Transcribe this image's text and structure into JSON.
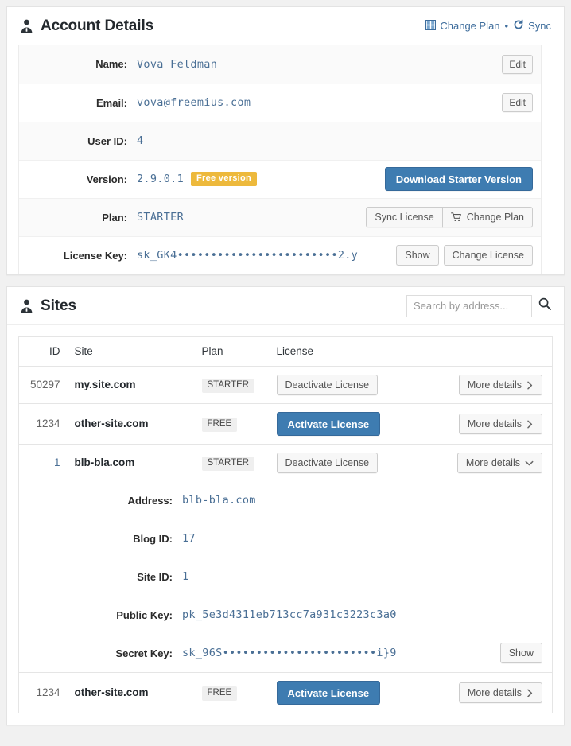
{
  "account": {
    "title": "Account Details",
    "header_links": {
      "change_plan": "Change Plan",
      "separator": "•",
      "sync": "Sync"
    },
    "rows": [
      {
        "label": "Name:",
        "value": "Vova Feldman",
        "action": "Edit"
      },
      {
        "label": "Email:",
        "value": "vova@freemius.com",
        "action": "Edit"
      },
      {
        "label": "User ID:",
        "value": "4",
        "action": ""
      },
      {
        "label": "Version:",
        "value": "2.9.0.1",
        "badge": "Free version",
        "action": "Download Starter Version"
      },
      {
        "label": "Plan:",
        "value": "STARTER",
        "action": "Sync License",
        "action2": "Change Plan"
      },
      {
        "label": "License Key:",
        "value": "sk_GK4••••••••••••••••••••••••2.y",
        "action": "Show",
        "action2": "Change License"
      }
    ]
  },
  "sites": {
    "title": "Sites",
    "search": {
      "placeholder": "Search by address...",
      "value": ""
    },
    "columns": {
      "id": "ID",
      "site": "Site",
      "plan": "Plan",
      "license": "License"
    },
    "rows": [
      {
        "id": "50297",
        "site": "my.site.com",
        "plan": "STARTER",
        "license_action": "Deactivate License",
        "license_style": "default",
        "more": "More details",
        "expanded": false
      },
      {
        "id": "1234",
        "site": "other-site.com",
        "plan": "FREE",
        "license_action": "Activate License",
        "license_style": "primary",
        "more": "More details",
        "expanded": false
      },
      {
        "id": "1",
        "site": "blb-bla.com",
        "plan": "STARTER",
        "license_action": "Deactivate License",
        "license_style": "default",
        "more": "More details",
        "expanded": true,
        "details": [
          {
            "label": "Address:",
            "value": "blb-bla.com",
            "action": ""
          },
          {
            "label": "Blog ID:",
            "value": "17",
            "action": ""
          },
          {
            "label": "Site ID:",
            "value": "1",
            "action": ""
          },
          {
            "label": "Public Key:",
            "value": "pk_5e3d4311eb713cc7a931c3223c3a0",
            "action": ""
          },
          {
            "label": "Secret Key:",
            "value": "sk_96S•••••••••••••••••••••••i}9",
            "action": "Show"
          }
        ]
      },
      {
        "id": "1234",
        "site": "other-site.com",
        "plan": "FREE",
        "license_action": "Activate License",
        "license_style": "primary",
        "more": "More details",
        "expanded": false
      }
    ]
  },
  "colors": {
    "accent_blue": "#3e7cb1",
    "link_blue": "#3e6d9c",
    "mono_value": "#4a6f95",
    "badge_amber": "#edb93c",
    "page_bg": "#f1f1f1"
  }
}
